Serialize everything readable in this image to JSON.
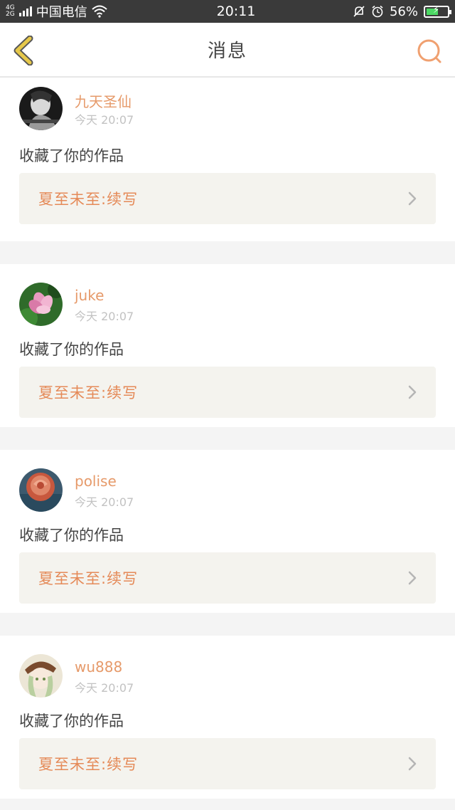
{
  "statusbar": {
    "network_top": "4G",
    "network_bottom": "2G",
    "carrier": "中国电信",
    "time": "20:11",
    "battery_percent": "56%",
    "battery_level": 0.56
  },
  "navbar": {
    "title": "消息"
  },
  "messages": [
    {
      "username": "九天圣仙",
      "time": "今天 20:07",
      "action": "收藏了你的作品",
      "work_title": "夏至未至:续写"
    },
    {
      "username": "juke",
      "time": "今天 20:07",
      "action": "收藏了你的作品",
      "work_title": "夏至未至:续写"
    },
    {
      "username": "polise",
      "time": "今天 20:07",
      "action": "收藏了你的作品",
      "work_title": "夏至未至:续写"
    },
    {
      "username": "wu888",
      "time": "今天 20:07",
      "action": "收藏了你的作品",
      "work_title": "夏至未至:续写"
    }
  ],
  "colors": {
    "accent": "#e69a6a",
    "back_icon": "#e6c84a"
  }
}
